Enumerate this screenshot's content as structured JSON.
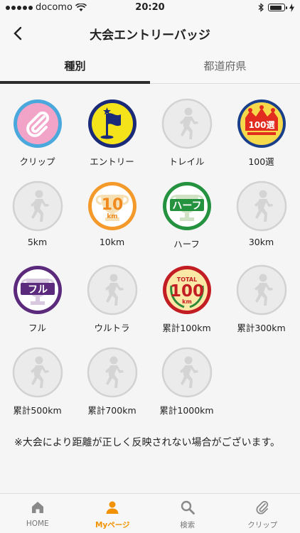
{
  "status_bar": {
    "carrier": "docomo",
    "time": "20:20",
    "battery_level": 0.85
  },
  "nav": {
    "title": "大会エントリーバッジ"
  },
  "tabs": [
    {
      "label": "種別",
      "active": true
    },
    {
      "label": "都道府県",
      "active": false
    }
  ],
  "badges": [
    {
      "label": "クリップ",
      "icon": "clip-icon",
      "earned": true
    },
    {
      "label": "エントリー",
      "icon": "flag-icon",
      "earned": true
    },
    {
      "label": "トレイル",
      "icon": "runner-icon",
      "earned": false
    },
    {
      "label": "100選",
      "icon": "crown-icon",
      "earned": true,
      "text": "100選"
    },
    {
      "label": "5km",
      "icon": "runner-icon",
      "earned": false
    },
    {
      "label": "10km",
      "icon": "trophy-icon",
      "earned": true,
      "text": "10",
      "sub": "km"
    },
    {
      "label": "ハーフ",
      "icon": "trophy-icon",
      "earned": true,
      "text": "ハーフ"
    },
    {
      "label": "30km",
      "icon": "runner-icon",
      "earned": false
    },
    {
      "label": "フル",
      "icon": "trophy-icon",
      "earned": true,
      "text": "フル"
    },
    {
      "label": "ウルトラ",
      "icon": "runner-icon",
      "earned": false
    },
    {
      "label": "累計100km",
      "icon": "laurel-icon",
      "earned": true,
      "text_top": "TOTAL",
      "text": "100",
      "sub": "km"
    },
    {
      "label": "累計300km",
      "icon": "runner-icon",
      "earned": false
    },
    {
      "label": "累計500km",
      "icon": "runner-icon",
      "earned": false
    },
    {
      "label": "累計700km",
      "icon": "runner-icon",
      "earned": false
    },
    {
      "label": "累計1000km",
      "icon": "runner-icon",
      "earned": false
    }
  ],
  "note": "※大会により距離が正しく反映されない場合がございます。",
  "bottom_nav": [
    {
      "label": "HOME",
      "icon": "home-icon",
      "active": false
    },
    {
      "label": "Myページ",
      "icon": "person-icon",
      "active": true
    },
    {
      "label": "検索",
      "icon": "search-icon",
      "active": false
    },
    {
      "label": "クリップ",
      "icon": "clip-icon",
      "active": false
    }
  ],
  "colors": {
    "accent": "#f39200",
    "inactive_badge": "#e6e6e6"
  }
}
